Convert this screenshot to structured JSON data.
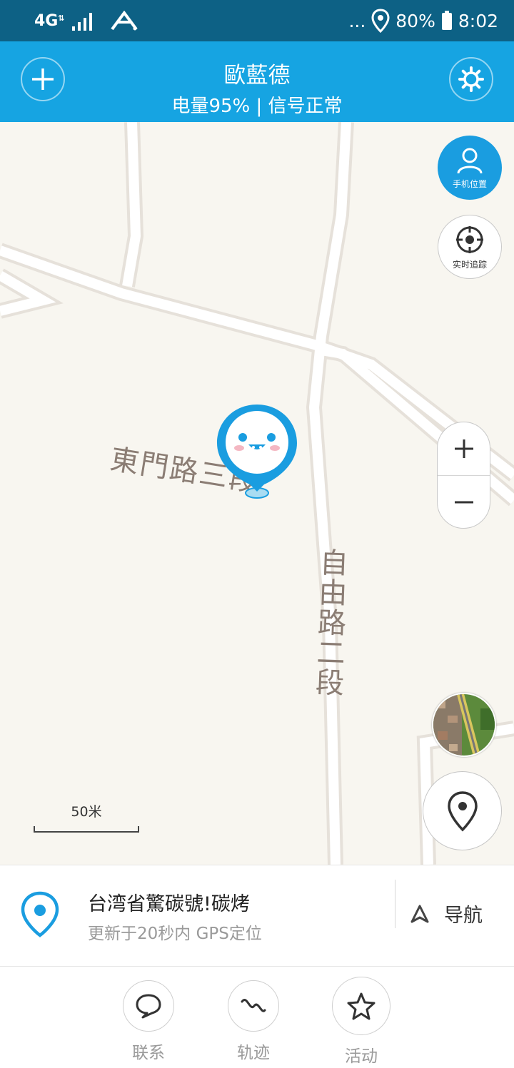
{
  "status_bar": {
    "network": "4G",
    "dots": "...",
    "battery": "80%",
    "time": "8:02"
  },
  "header": {
    "title": "歐藍德",
    "subtitle": "电量95% | 信号正常"
  },
  "map": {
    "roads": [
      "東門路三段",
      "自由路二段"
    ],
    "phone_location_label": "手机位置",
    "realtime_tracking_label": "实时追踪",
    "scale_label": "50米"
  },
  "location": {
    "address": "台湾省驚碳號!碳烤",
    "update": "更新于20秒内  GPS定位",
    "navigate_label": "导航"
  },
  "tabs": [
    {
      "label": "联系",
      "icon": "chat-bubble-icon"
    },
    {
      "label": "轨迹",
      "icon": "track-wave-icon"
    },
    {
      "label": "活动",
      "icon": "star-icon"
    }
  ],
  "colors": {
    "status_bar": "#0d6185",
    "header": "#16a4e2",
    "accent": "#1a9de0",
    "map_bg": "#f8f6f0"
  }
}
